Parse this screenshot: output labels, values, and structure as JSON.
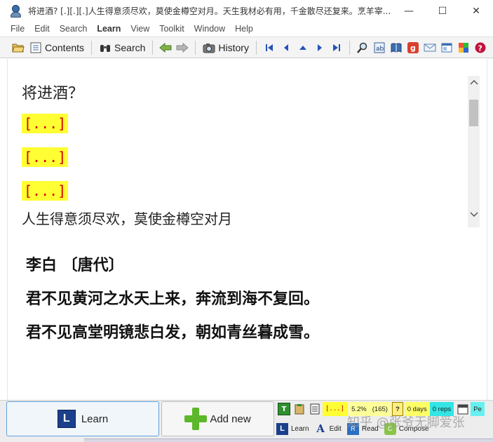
{
  "window": {
    "title": "将进酒? [.][.][.]人生得意须尽欢，莫使金樽空对月。天生我材必有用，千金散尽还复来。烹羊宰...",
    "minimize_glyph": "—",
    "maximize_glyph": "☐",
    "close_glyph": "✕"
  },
  "menu": {
    "items": [
      {
        "label": "File"
      },
      {
        "label": "Edit"
      },
      {
        "label": "Search"
      },
      {
        "label": "Learn"
      },
      {
        "label": "View"
      },
      {
        "label": "Toolkit"
      },
      {
        "label": "Window"
      },
      {
        "label": "Help"
      }
    ]
  },
  "toolbar": {
    "contents_label": "Contents",
    "search_label": "Search",
    "history_label": "History"
  },
  "question": {
    "title": "将进酒？",
    "clozes": [
      "[...]",
      "[...]",
      "[...]"
    ],
    "cutoff_line": "人生得意须尽欢，莫使金樽空对月"
  },
  "answer": {
    "lines": [
      "李白 〔唐代〕",
      "君不见黄河之水天上来，奔流到海不复回。",
      "君不见高堂明镜悲白发，朝如青丝暮成雪。"
    ]
  },
  "bottom": {
    "learn_label": "Learn",
    "add_new_label": "Add new",
    "status": {
      "cloze_icon_text": "[...]",
      "percent": "5.2%",
      "count": "(165)",
      "help_glyph": "?",
      "days": "0 days",
      "reps": "0 reps",
      "priority": "Pe"
    },
    "tabs": [
      {
        "label": "Learn",
        "icon": "L"
      },
      {
        "label": "Edit",
        "icon": "A"
      },
      {
        "label": "Read",
        "icon": "R"
      },
      {
        "label": "Compose",
        "icon": "C"
      }
    ],
    "watermark": "知乎 @张爷无脚爱张"
  },
  "colors": {
    "cloze_background": "#ffff33",
    "cloze_text": "#d40000",
    "learn_icon": "#1b3f8a",
    "add_icon": "#5cb82a",
    "days_box": "#ffff66",
    "reps_box": "#33e5e5",
    "percent_box": "#ffff99"
  }
}
